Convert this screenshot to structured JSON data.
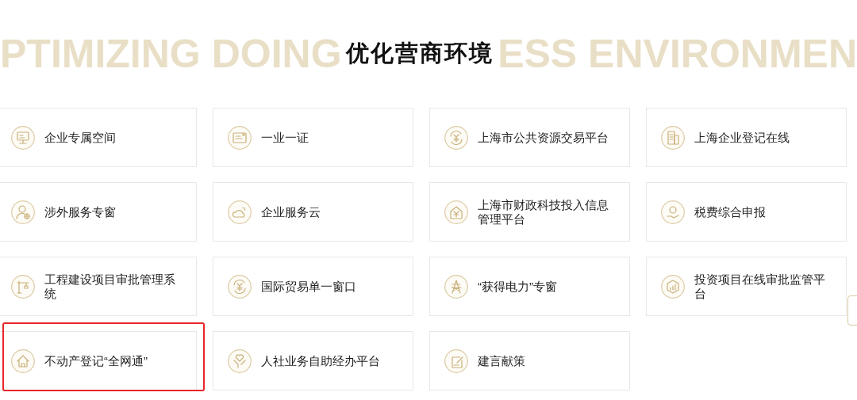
{
  "banner": {
    "backdrop_left": "PTIMIZING DOING",
    "title": "优化营商环境",
    "backdrop_right": "ESS ENVIRONMEN"
  },
  "services": [
    {
      "label": "企业专属空间",
      "kind": "monitor",
      "highlighted": false
    },
    {
      "label": "一业一证",
      "kind": "card",
      "highlighted": false
    },
    {
      "label": "上海市公共资源交易平台",
      "kind": "yen-cycle",
      "highlighted": false
    },
    {
      "label": "上海企业登记在线",
      "kind": "building",
      "highlighted": false
    },
    {
      "label": "涉外服务专窗",
      "kind": "person",
      "highlighted": false
    },
    {
      "label": "企业服务云",
      "kind": "cloud",
      "highlighted": false
    },
    {
      "label": "上海市财政科技投入信息管理平台",
      "kind": "yen-house",
      "highlighted": false
    },
    {
      "label": "税费综合申报",
      "kind": "hand-coin",
      "highlighted": false
    },
    {
      "label": "工程建设项目审批管理系统",
      "kind": "crane",
      "highlighted": false
    },
    {
      "label": "国际贸易单一窗口",
      "kind": "yen-cycle",
      "highlighted": false
    },
    {
      "label": "“获得电力”专窗",
      "kind": "tower",
      "highlighted": false
    },
    {
      "label": "投资项目在线审批监管平台",
      "kind": "chart",
      "highlighted": false
    },
    {
      "label": "不动产登记“全网通”",
      "kind": "house",
      "highlighted": true
    },
    {
      "label": "人社业务自助经办平台",
      "kind": "heart",
      "highlighted": false
    },
    {
      "label": "建言献策",
      "kind": "edit",
      "highlighted": false
    }
  ]
}
